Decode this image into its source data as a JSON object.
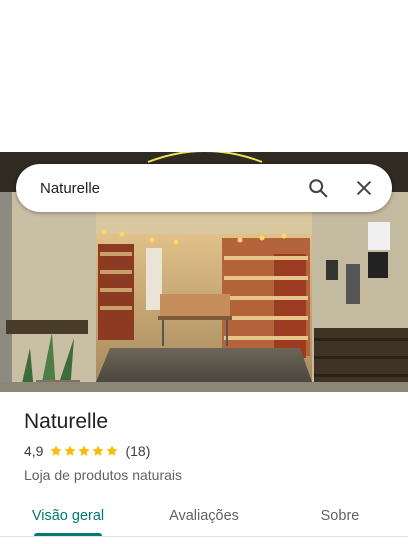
{
  "search": {
    "query": "Naturelle"
  },
  "place": {
    "name": "Naturelle",
    "rating": "4,9",
    "stars": 5,
    "review_count": "(18)",
    "category": "Loja de produtos naturais"
  },
  "tabs": [
    {
      "label": "Visão geral",
      "active": true
    },
    {
      "label": "Avaliações",
      "active": false
    },
    {
      "label": "Sobre",
      "active": false
    }
  ],
  "colors": {
    "accent": "#01796f",
    "star": "#fbbc04"
  },
  "icons": {
    "search": "search-icon",
    "close": "close-icon",
    "star": "star-icon"
  }
}
